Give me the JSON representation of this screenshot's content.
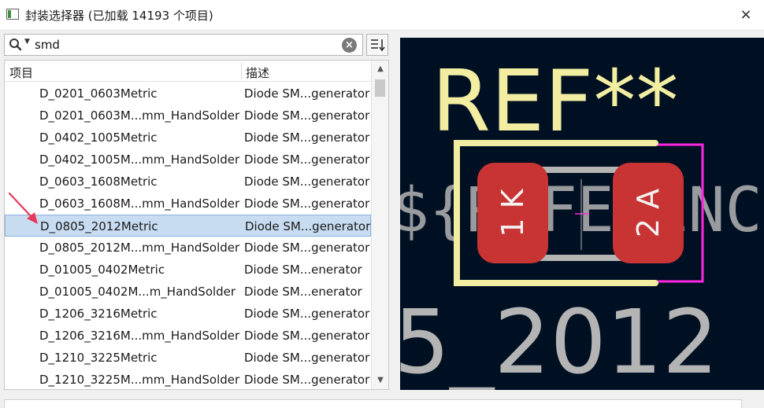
{
  "window": {
    "title": "封装选择器 (已加载 14193 个项目)",
    "close_icon": "×"
  },
  "search": {
    "value": "smd",
    "clear_icon": "×"
  },
  "list": {
    "columns": [
      "项目",
      "描述"
    ],
    "rows": [
      {
        "name": "D_0201_0603Metric",
        "desc": "Diode SM...generator"
      },
      {
        "name": "D_0201_0603M...mm_HandSolder",
        "desc": "Diode SM...generator"
      },
      {
        "name": "D_0402_1005Metric",
        "desc": "Diode SM...generator"
      },
      {
        "name": "D_0402_1005M...mm_HandSolder",
        "desc": "Diode SM...generator"
      },
      {
        "name": "D_0603_1608Metric",
        "desc": "Diode SM...generator"
      },
      {
        "name": "D_0603_1608M...mm_HandSolder",
        "desc": "Diode SM...generator"
      },
      {
        "name": "D_0805_2012Metric",
        "desc": "Diode SM...generator"
      },
      {
        "name": "D_0805_2012M...mm_HandSolder",
        "desc": "Diode SM...generator"
      },
      {
        "name": "D_01005_0402Metric",
        "desc": "Diode SM...enerator"
      },
      {
        "name": "D_01005_0402M...m_HandSolder",
        "desc": "Diode SM...enerator"
      },
      {
        "name": "D_1206_3216Metric",
        "desc": "Diode SM...generator"
      },
      {
        "name": "D_1206_3216M...mm_HandSolder",
        "desc": "Diode SM...generator"
      },
      {
        "name": "D_1210_3225Metric",
        "desc": "Diode SM...generator"
      },
      {
        "name": "D_1210_3225M...mm_HandSolder",
        "desc": "Diode SM...generator"
      }
    ],
    "selected_index": 6
  },
  "preview": {
    "ref_text": "REF**",
    "value_text": "${REFERENCE}",
    "fab_text": "5_2012",
    "pad1_label": "1 K",
    "pad2_label": "2 A",
    "colors": {
      "background": "#001023",
      "silkscreen": "#f2eda1",
      "fab": "#b4b4b4",
      "courtyard": "#ff26e2",
      "pad": "#c83434"
    }
  }
}
